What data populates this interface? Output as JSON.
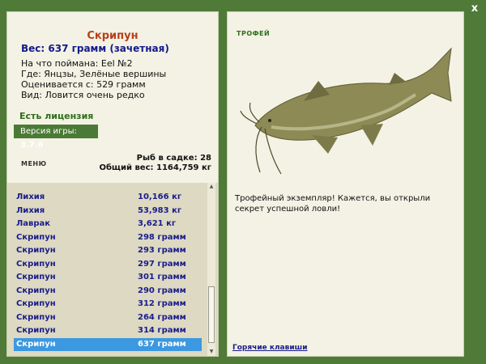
{
  "fish": {
    "name": "Скрипун",
    "weight_line": "Вес: 637 грамм (зачетная)",
    "caught_with": "На что поймана: Eel №2",
    "location": "Где: Янцзы, Зелёные вершины",
    "valued_from": "Оценивается с: 529 грамм",
    "rarity": "Вид: Ловится очень редко"
  },
  "license": "Есть лицензия",
  "version": {
    "label": "Версия игры:",
    "value": "3.7.6"
  },
  "menu_label": "МЕНЮ",
  "stats": {
    "fish_count": "Рыб в садке: 28",
    "total_weight": "Общий вес: 1164,759 кг"
  },
  "catch_list": [
    {
      "name": "Лихия",
      "weight": "10,166 кг"
    },
    {
      "name": "Лихия",
      "weight": "53,983 кг"
    },
    {
      "name": "Лаврак",
      "weight": "3,621 кг"
    },
    {
      "name": "Скрипун",
      "weight": "298 грамм"
    },
    {
      "name": "Скрипун",
      "weight": "293 грамм"
    },
    {
      "name": "Скрипун",
      "weight": "297 грамм"
    },
    {
      "name": "Скрипун",
      "weight": "301 грамм"
    },
    {
      "name": "Скрипун",
      "weight": "290 грамм"
    },
    {
      "name": "Скрипун",
      "weight": "312 грамм"
    },
    {
      "name": "Скрипун",
      "weight": "264 грамм"
    },
    {
      "name": "Скрипун",
      "weight": "314 грамм"
    },
    {
      "name": "Скрипун",
      "weight": "637 грамм"
    }
  ],
  "selected_index": 11,
  "trophy": {
    "label": "ТРОФЕЙ",
    "text": "Трофейный экземпляр! Кажется, вы открыли секрет успешной ловли!"
  },
  "hotkeys": "Горячие клавиши",
  "close_label": "x",
  "colors": {
    "frame": "#4f7a38",
    "panel": "#f3f2e4",
    "selection": "#3c98e0",
    "title": "#b8401a",
    "link": "#1a1c8a"
  },
  "icons": {
    "close": "close-icon",
    "scroll_up": "arrow-up-icon",
    "scroll_down": "arrow-down-icon"
  }
}
